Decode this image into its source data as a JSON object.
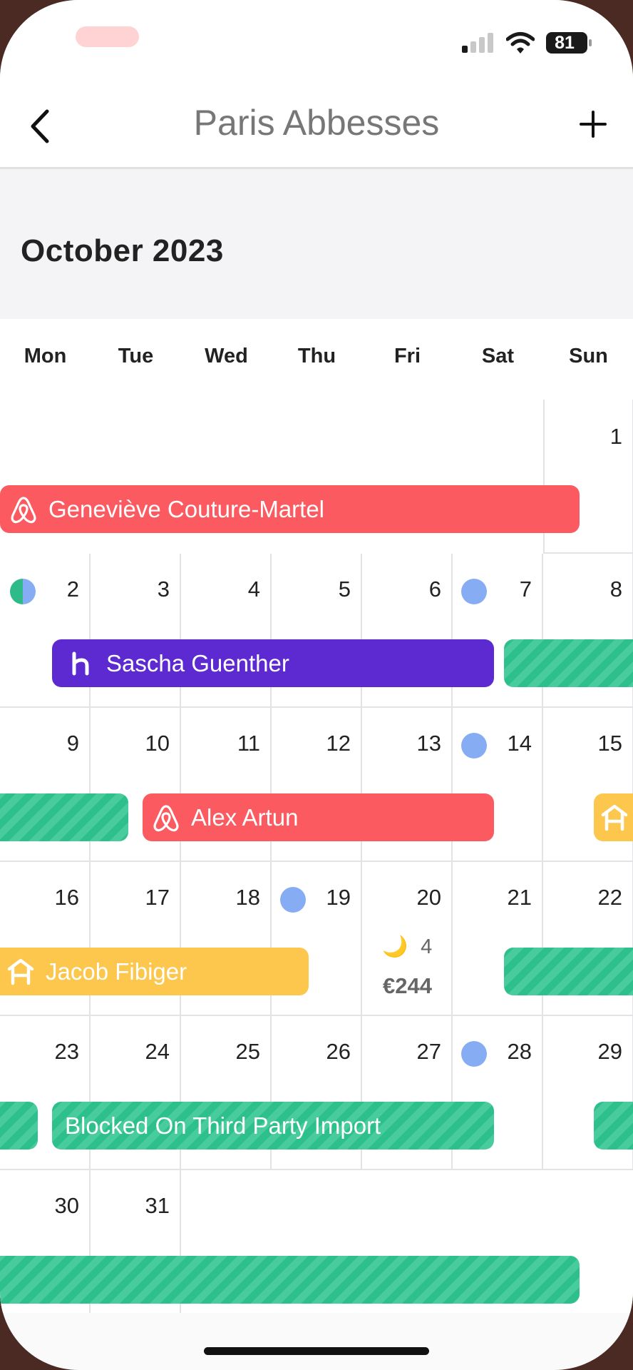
{
  "status_bar": {
    "battery": "81"
  },
  "nav": {
    "title": "Paris Abbesses",
    "back_icon": "chevron-left-icon",
    "add_icon": "plus-icon"
  },
  "calendar": {
    "month_label": "October 2023",
    "weekdays": [
      "Mon",
      "Tue",
      "Wed",
      "Thu",
      "Fri",
      "Sat",
      "Sun"
    ],
    "days": [
      "1",
      "2",
      "3",
      "4",
      "5",
      "6",
      "7",
      "8",
      "9",
      "10",
      "11",
      "12",
      "13",
      "14",
      "15",
      "16",
      "17",
      "18",
      "19",
      "20",
      "21",
      "22",
      "23",
      "24",
      "25",
      "26",
      "27",
      "28",
      "29",
      "30",
      "31"
    ],
    "day20": {
      "nights": "4",
      "price": "€244"
    }
  },
  "bookings": [
    {
      "guest": "Geneviève Couture-Martel",
      "source": "airbnb-icon",
      "color": "#fb5a60"
    },
    {
      "guest": "Sascha Guenther",
      "source": "hostaway-h-icon",
      "color": "#5d2ad1"
    },
    {
      "guest": "Alex Artun",
      "source": "airbnb-icon",
      "color": "#fb5a60"
    },
    {
      "guest": "Jacob Fibiger",
      "source": "house-icon",
      "color": "#fdc64c"
    },
    {
      "guest": "Blocked On Third Party Import",
      "source": "",
      "color": "#2dbf8c"
    }
  ],
  "colors": {
    "blocked": "#2dbf8c",
    "dot": "#86adf4",
    "grid_line": "#e3e3e5"
  }
}
